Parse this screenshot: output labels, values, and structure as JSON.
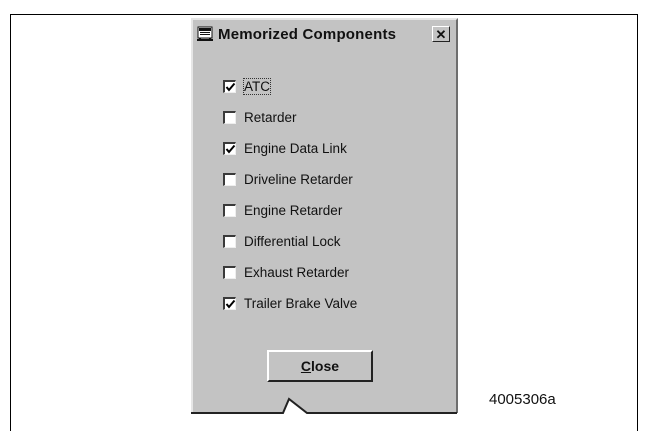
{
  "dialog": {
    "title": "Memorized Components",
    "title_icon": "app-window-icon",
    "close_icon": "close-x-icon",
    "components": [
      {
        "label": "ATC",
        "checked": true,
        "focused": true
      },
      {
        "label": "Retarder",
        "checked": false
      },
      {
        "label": "Engine Data Link",
        "checked": true
      },
      {
        "label": "Driveline Retarder",
        "checked": false
      },
      {
        "label": "Engine Retarder",
        "checked": false
      },
      {
        "label": "Differential Lock",
        "checked": false
      },
      {
        "label": "Exhaust Retarder",
        "checked": false
      },
      {
        "label": "Trailer Brake Valve",
        "checked": true
      }
    ],
    "close_button": {
      "mnemonic": "C",
      "rest": "lose"
    }
  },
  "figure_id": "4005306a"
}
